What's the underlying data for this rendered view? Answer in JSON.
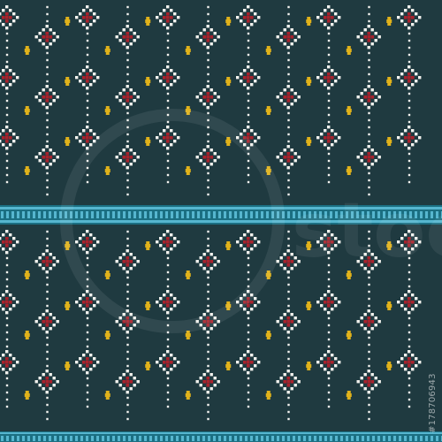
{
  "pattern": {
    "colors": {
      "background": "#1f3a40",
      "stitch_white": "#f2f2ee",
      "diamond_red": "#a8222c",
      "dot_yellow": "#e0b21b",
      "border_light": "#56b6cf",
      "border_dark": "#1b6f82"
    }
  },
  "watermark": {
    "logo_text": "stock",
    "stock_id": "#178706943"
  }
}
